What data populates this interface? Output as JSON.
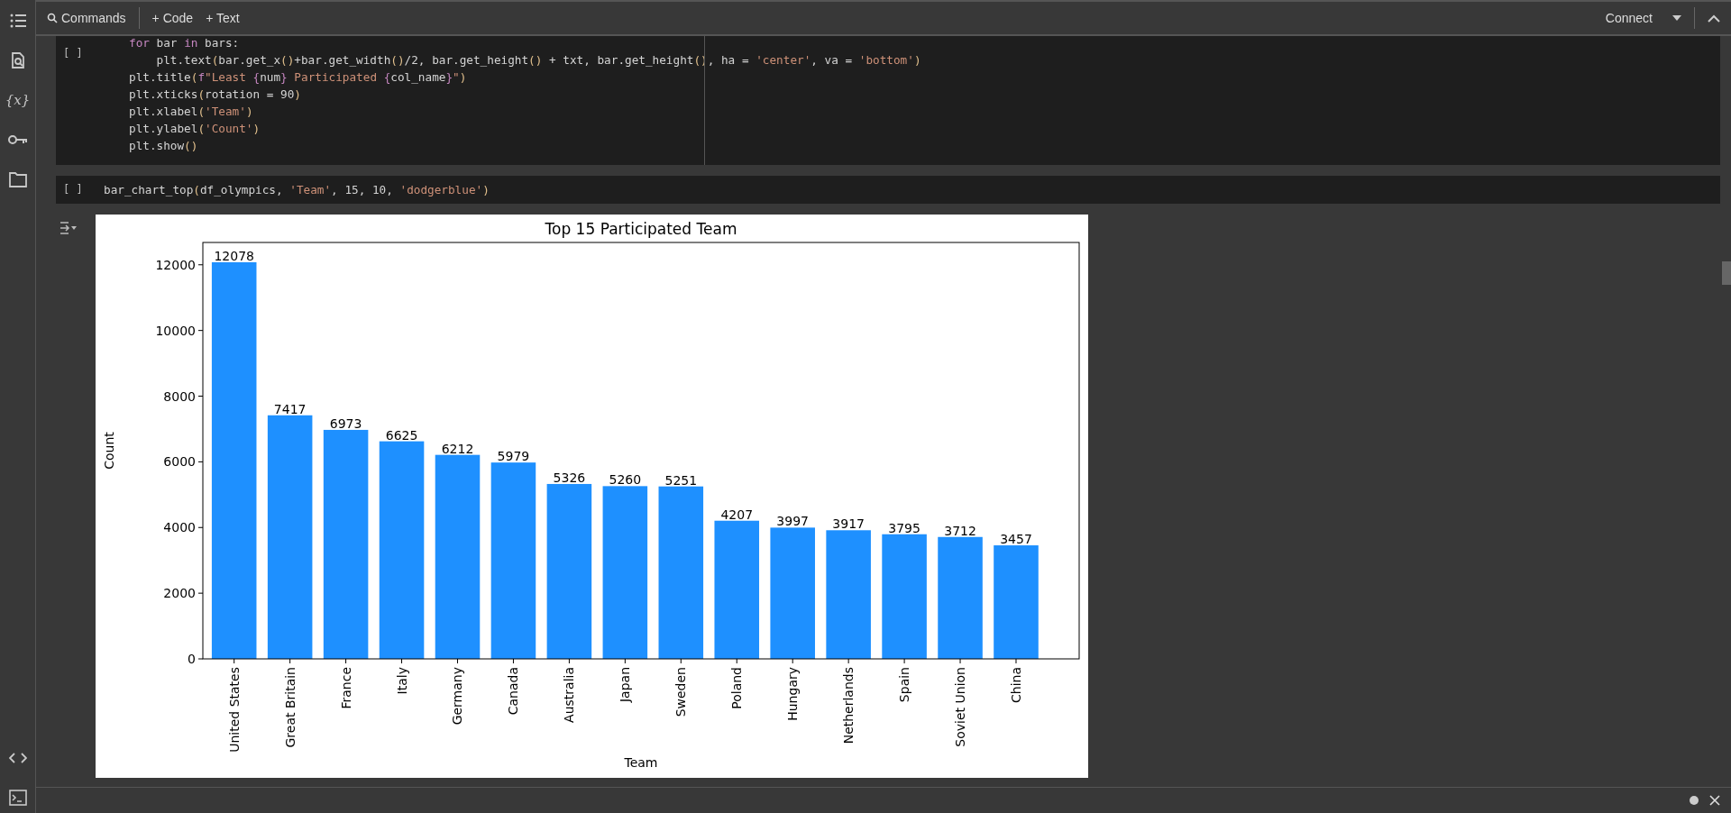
{
  "sidebar": {
    "top_icons": [
      {
        "kind": "toc"
      },
      {
        "kind": "find"
      },
      {
        "kind": "variables",
        "label": "{x}"
      },
      {
        "kind": "secrets"
      },
      {
        "kind": "files"
      }
    ],
    "bottom_icons": [
      {
        "kind": "code"
      },
      {
        "kind": "terminal"
      }
    ]
  },
  "toolbar": {
    "commands": "Commands",
    "add_code": "+ Code",
    "add_text": "+ Text",
    "connect": "Connect"
  },
  "cells": [
    {
      "run_label": "[ ]",
      "lines": [
        [
          {
            "kind": "kw",
            "text": "for"
          },
          {
            "kind": "plain",
            "text": " bar "
          },
          {
            "kind": "kw",
            "text": "in"
          },
          {
            "kind": "plain",
            "text": " bars:"
          }
        ],
        [
          {
            "kind": "plain",
            "text": "    plt.text"
          },
          {
            "kind": "paren",
            "text": "("
          },
          {
            "kind": "plain",
            "text": "bar.get_x"
          },
          {
            "kind": "paren",
            "text": "()"
          },
          {
            "kind": "plain",
            "text": "+bar.get_width"
          },
          {
            "kind": "paren",
            "text": "()"
          },
          {
            "kind": "plain",
            "text": "/2, bar.get_height"
          },
          {
            "kind": "paren",
            "text": "()"
          },
          {
            "kind": "plain",
            "text": " + txt, bar.get_height"
          },
          {
            "kind": "paren",
            "text": "()"
          },
          {
            "kind": "plain",
            "text": ", ha = "
          },
          {
            "kind": "str",
            "text": "'center'"
          },
          {
            "kind": "plain",
            "text": ", va = "
          },
          {
            "kind": "str",
            "text": "'bottom'"
          },
          {
            "kind": "paren",
            "text": ")"
          }
        ],
        [
          {
            "kind": "plain",
            "text": "plt.title"
          },
          {
            "kind": "paren",
            "text": "("
          },
          {
            "kind": "kw",
            "text": "f"
          },
          {
            "kind": "str",
            "text": "\"Least "
          },
          {
            "kind": "kw",
            "text": "{"
          },
          {
            "kind": "plain",
            "text": "num"
          },
          {
            "kind": "kw",
            "text": "}"
          },
          {
            "kind": "str",
            "text": " Participated "
          },
          {
            "kind": "kw",
            "text": "{"
          },
          {
            "kind": "plain",
            "text": "col_name"
          },
          {
            "kind": "kw",
            "text": "}"
          },
          {
            "kind": "str",
            "text": "\""
          },
          {
            "kind": "paren",
            "text": ")"
          }
        ],
        [
          {
            "kind": "plain",
            "text": "plt.xticks"
          },
          {
            "kind": "paren",
            "text": "("
          },
          {
            "kind": "plain",
            "text": "rotation = 90"
          },
          {
            "kind": "paren",
            "text": ")"
          }
        ],
        [
          {
            "kind": "plain",
            "text": "plt.xlabel"
          },
          {
            "kind": "paren",
            "text": "("
          },
          {
            "kind": "str",
            "text": "'Team'"
          },
          {
            "kind": "paren",
            "text": ")"
          }
        ],
        [
          {
            "kind": "plain",
            "text": "plt.ylabel"
          },
          {
            "kind": "paren",
            "text": "("
          },
          {
            "kind": "str",
            "text": "'Count'"
          },
          {
            "kind": "paren",
            "text": ")"
          }
        ],
        [
          {
            "kind": "plain",
            "text": "plt.show"
          },
          {
            "kind": "paren",
            "text": "()"
          }
        ]
      ]
    },
    {
      "run_label": "[ ]",
      "lines": [
        [
          {
            "kind": "plain",
            "text": "bar_chart_top"
          },
          {
            "kind": "paren",
            "text": "("
          },
          {
            "kind": "plain",
            "text": "df_olympics, "
          },
          {
            "kind": "str",
            "text": "'Team'"
          },
          {
            "kind": "plain",
            "text": ", 15, 10, "
          },
          {
            "kind": "str",
            "text": "'dodgerblue'"
          },
          {
            "kind": "paren",
            "text": ")"
          }
        ]
      ]
    }
  ],
  "output": {
    "chart_data": {
      "type": "bar",
      "title": "Top 15 Participated Team",
      "xlabel": "Team",
      "ylabel": "Count",
      "categories": [
        "United States",
        "Great Britain",
        "France",
        "Italy",
        "Germany",
        "Canada",
        "Australia",
        "Japan",
        "Sweden",
        "Poland",
        "Hungary",
        "Netherlands",
        "Spain",
        "Soviet Union",
        "China"
      ],
      "series": [
        {
          "color": "#1e90ff",
          "values": [
            12078,
            7417,
            6973,
            6625,
            6212,
            5979,
            5326,
            5260,
            5251,
            4207,
            3997,
            3917,
            3795,
            3712,
            3457
          ]
        }
      ],
      "ylim": [
        0,
        12680
      ],
      "yticks": [
        0,
        2000,
        4000,
        6000,
        8000,
        10000,
        12000
      ],
      "data_labels": true
    }
  }
}
